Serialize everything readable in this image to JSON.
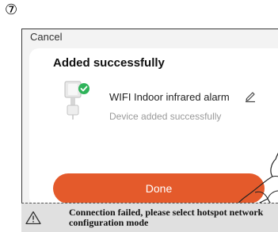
{
  "step": {
    "marker": "⑦"
  },
  "app": {
    "cancel_label": "Cancel"
  },
  "dialog": {
    "title": "Added successfully",
    "device": {
      "name": "WIFI Indoor infrared alarm",
      "status": "Device added successfully",
      "icon": "alarm-device-icon",
      "badge_icon": "check-badge-icon"
    },
    "done_label": "Done"
  },
  "note": {
    "icon": "warning-icon",
    "text": "Connection failed, please select hotspot network configuration mode"
  },
  "colors": {
    "accent": "#e45a2b",
    "success": "#2fb35a",
    "note_background": "#e0e0e0",
    "card_background": "#ffffff",
    "screen_background": "#f3f3f3"
  }
}
